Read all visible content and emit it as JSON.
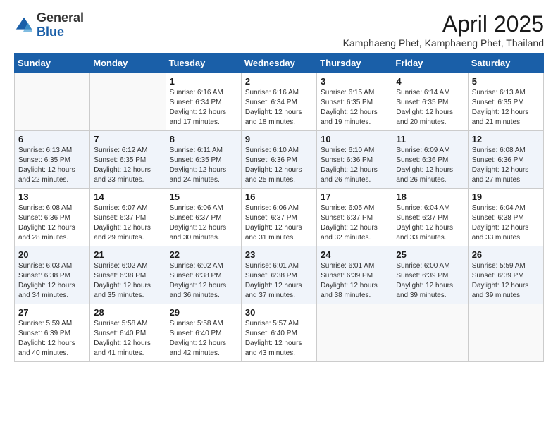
{
  "logo": {
    "general": "General",
    "blue": "Blue"
  },
  "header": {
    "title": "April 2025",
    "subtitle": "Kamphaeng Phet, Kamphaeng Phet, Thailand"
  },
  "weekdays": [
    "Sunday",
    "Monday",
    "Tuesday",
    "Wednesday",
    "Thursday",
    "Friday",
    "Saturday"
  ],
  "weeks": [
    [
      {
        "day": "",
        "info": ""
      },
      {
        "day": "",
        "info": ""
      },
      {
        "day": "1",
        "info": "Sunrise: 6:16 AM\nSunset: 6:34 PM\nDaylight: 12 hours and 17 minutes."
      },
      {
        "day": "2",
        "info": "Sunrise: 6:16 AM\nSunset: 6:34 PM\nDaylight: 12 hours and 18 minutes."
      },
      {
        "day": "3",
        "info": "Sunrise: 6:15 AM\nSunset: 6:35 PM\nDaylight: 12 hours and 19 minutes."
      },
      {
        "day": "4",
        "info": "Sunrise: 6:14 AM\nSunset: 6:35 PM\nDaylight: 12 hours and 20 minutes."
      },
      {
        "day": "5",
        "info": "Sunrise: 6:13 AM\nSunset: 6:35 PM\nDaylight: 12 hours and 21 minutes."
      }
    ],
    [
      {
        "day": "6",
        "info": "Sunrise: 6:13 AM\nSunset: 6:35 PM\nDaylight: 12 hours and 22 minutes."
      },
      {
        "day": "7",
        "info": "Sunrise: 6:12 AM\nSunset: 6:35 PM\nDaylight: 12 hours and 23 minutes."
      },
      {
        "day": "8",
        "info": "Sunrise: 6:11 AM\nSunset: 6:35 PM\nDaylight: 12 hours and 24 minutes."
      },
      {
        "day": "9",
        "info": "Sunrise: 6:10 AM\nSunset: 6:36 PM\nDaylight: 12 hours and 25 minutes."
      },
      {
        "day": "10",
        "info": "Sunrise: 6:10 AM\nSunset: 6:36 PM\nDaylight: 12 hours and 26 minutes."
      },
      {
        "day": "11",
        "info": "Sunrise: 6:09 AM\nSunset: 6:36 PM\nDaylight: 12 hours and 26 minutes."
      },
      {
        "day": "12",
        "info": "Sunrise: 6:08 AM\nSunset: 6:36 PM\nDaylight: 12 hours and 27 minutes."
      }
    ],
    [
      {
        "day": "13",
        "info": "Sunrise: 6:08 AM\nSunset: 6:36 PM\nDaylight: 12 hours and 28 minutes."
      },
      {
        "day": "14",
        "info": "Sunrise: 6:07 AM\nSunset: 6:37 PM\nDaylight: 12 hours and 29 minutes."
      },
      {
        "day": "15",
        "info": "Sunrise: 6:06 AM\nSunset: 6:37 PM\nDaylight: 12 hours and 30 minutes."
      },
      {
        "day": "16",
        "info": "Sunrise: 6:06 AM\nSunset: 6:37 PM\nDaylight: 12 hours and 31 minutes."
      },
      {
        "day": "17",
        "info": "Sunrise: 6:05 AM\nSunset: 6:37 PM\nDaylight: 12 hours and 32 minutes."
      },
      {
        "day": "18",
        "info": "Sunrise: 6:04 AM\nSunset: 6:37 PM\nDaylight: 12 hours and 33 minutes."
      },
      {
        "day": "19",
        "info": "Sunrise: 6:04 AM\nSunset: 6:38 PM\nDaylight: 12 hours and 33 minutes."
      }
    ],
    [
      {
        "day": "20",
        "info": "Sunrise: 6:03 AM\nSunset: 6:38 PM\nDaylight: 12 hours and 34 minutes."
      },
      {
        "day": "21",
        "info": "Sunrise: 6:02 AM\nSunset: 6:38 PM\nDaylight: 12 hours and 35 minutes."
      },
      {
        "day": "22",
        "info": "Sunrise: 6:02 AM\nSunset: 6:38 PM\nDaylight: 12 hours and 36 minutes."
      },
      {
        "day": "23",
        "info": "Sunrise: 6:01 AM\nSunset: 6:38 PM\nDaylight: 12 hours and 37 minutes."
      },
      {
        "day": "24",
        "info": "Sunrise: 6:01 AM\nSunset: 6:39 PM\nDaylight: 12 hours and 38 minutes."
      },
      {
        "day": "25",
        "info": "Sunrise: 6:00 AM\nSunset: 6:39 PM\nDaylight: 12 hours and 39 minutes."
      },
      {
        "day": "26",
        "info": "Sunrise: 5:59 AM\nSunset: 6:39 PM\nDaylight: 12 hours and 39 minutes."
      }
    ],
    [
      {
        "day": "27",
        "info": "Sunrise: 5:59 AM\nSunset: 6:39 PM\nDaylight: 12 hours and 40 minutes."
      },
      {
        "day": "28",
        "info": "Sunrise: 5:58 AM\nSunset: 6:40 PM\nDaylight: 12 hours and 41 minutes."
      },
      {
        "day": "29",
        "info": "Sunrise: 5:58 AM\nSunset: 6:40 PM\nDaylight: 12 hours and 42 minutes."
      },
      {
        "day": "30",
        "info": "Sunrise: 5:57 AM\nSunset: 6:40 PM\nDaylight: 12 hours and 43 minutes."
      },
      {
        "day": "",
        "info": ""
      },
      {
        "day": "",
        "info": ""
      },
      {
        "day": "",
        "info": ""
      }
    ]
  ]
}
